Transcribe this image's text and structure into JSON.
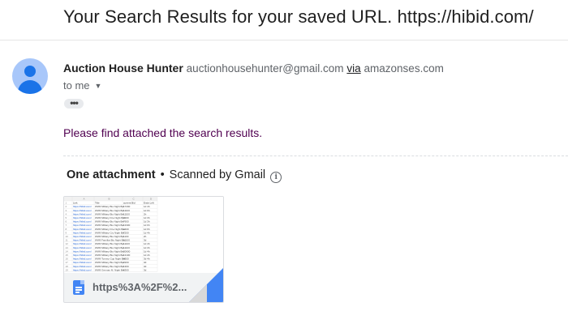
{
  "email": {
    "subject": "Your Search Results for your saved URL. https://hibid.com/",
    "sender": {
      "name": "Auction House Hunter",
      "email": "auctionhousehunter@gmail.com",
      "via_label": "via",
      "via_domain": "amazonses.com"
    },
    "recipient_label": "to me",
    "trimmed_content_label": "•••",
    "body": "Please find attached the search results."
  },
  "attachments": {
    "count_label": "One attachment",
    "separator": "•",
    "scan_label": "Scanned by Gmail",
    "items": [
      {
        "name": "https%3A%2F%2...",
        "file_icon": "google-docs-icon",
        "thumbnail": {
          "column_letters": [
            "A",
            "B",
            "C",
            "D"
          ],
          "column_headers": [
            "Link",
            "Title",
            "current Bid",
            "Ends Left"
          ],
          "rows": [
            [
              "https://hibid.com/",
              "WWII Military Bio Night Bet",
              "17200",
              "1d 4h"
            ],
            [
              "https://hibid.com/",
              "WWII Military Bio Night Bet",
              "11100",
              "1d 6h"
            ],
            [
              "https://hibid.com/",
              "WWII Military Bio Night Bet",
              "11100",
              "2h"
            ],
            [
              "https://hibid.com/",
              "WWII Military Fire Night Bet",
              "6300",
              "1d 3h"
            ],
            [
              "https://hibid.com/",
              "WWII Military Bio Night Bet",
              "7600",
              "1d 3h"
            ],
            [
              "https://hibid.com/",
              "WWII Military Bio Night Bet",
              "13300",
              "1d 6h"
            ],
            [
              "https://hibid.com/",
              "WWII Military Fire Night Bet",
              "1400",
              "1d 6h"
            ],
            [
              "https://hibid.com/",
              "WWII Military Cry Night Bet",
              "7200",
              "1d 4h"
            ],
            [
              "https://hibid.com/",
              "WWII Military Bio Night Bet",
              "1100",
              "2h"
            ],
            [
              "https://hibid.com/",
              "WWII Familiar Bio Night Bet",
              "11100",
              "3d"
            ],
            [
              "https://hibid.com/",
              "WWII Military Bio Night Bet",
              "11100",
              "1d 4h"
            ],
            [
              "https://hibid.com/",
              "WWII Military Bio Night Bet",
              "11100",
              "1d 3h"
            ],
            [
              "https://hibid.com/",
              "WWII Military Bio Night Bet",
              "20600",
              "1d 4h"
            ],
            [
              "https://hibid.com/",
              "WWII Military Bio Night Bet",
              "13100",
              "1d 4h"
            ],
            [
              "https://hibid.com/",
              "WWII Tommy Cup Night Bet",
              "6300",
              "3d 4h"
            ],
            [
              "https://hibid.com/",
              "WWII Military Bio Night Bet",
              "2200",
              "3d"
            ],
            [
              "https://hibid.com/",
              "WWII Military Bio Night Bet",
              "1300",
              "3d"
            ],
            [
              "https://hibid.com/",
              "WWII German M. Night Bet",
              "6300",
              "3d"
            ]
          ]
        }
      }
    ]
  },
  "colors": {
    "body_text": "#500050",
    "avatar_bg": "#a8c7fa",
    "avatar_fg": "#1a73e8",
    "doc_icon": "#4285f4",
    "link": "#1155cc"
  }
}
